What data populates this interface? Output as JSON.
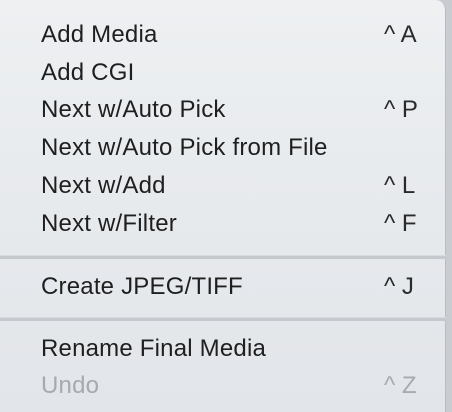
{
  "menu": {
    "items": [
      {
        "label": "Add Media",
        "shortcut": "^ A"
      },
      {
        "label": "Add CGI",
        "shortcut": ""
      },
      {
        "label": "Next w/Auto Pick",
        "shortcut": "^ P"
      },
      {
        "label": "Next w/Auto Pick from File",
        "shortcut": ""
      },
      {
        "label": "Next w/Add",
        "shortcut": "^ L"
      },
      {
        "label": "Next w/Filter",
        "shortcut": "^ F"
      },
      {
        "label": "Create JPEG/TIFF",
        "shortcut": "^ J"
      },
      {
        "label": "Rename Final Media",
        "shortcut": ""
      },
      {
        "label": "Undo",
        "shortcut": "^ Z",
        "disabled": true
      }
    ]
  },
  "colors": {
    "menu_background": "#e8ebee",
    "text": "#1f1f1f",
    "disabled_text": "#a7a9ad",
    "top_accent": "#2b6fd6"
  }
}
